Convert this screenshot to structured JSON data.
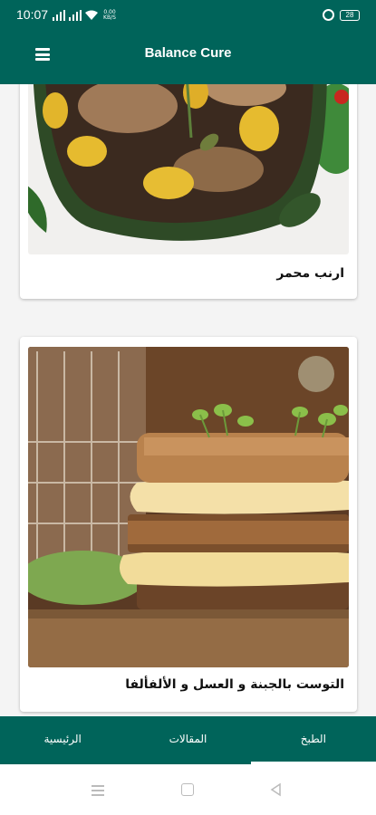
{
  "status_bar": {
    "time": "10:07",
    "net_speed": "0.00\nKB/S",
    "battery": "28"
  },
  "app_bar": {
    "title": "Balance Cure",
    "menu_icon": "hamburger-menu-icon"
  },
  "articles": [
    {
      "title": "ارنب محمر",
      "image": "braised-rabbit-with-potatoes-photo"
    },
    {
      "title": "التوست بالجبنة و العسل و الألفألفا",
      "image": "cheese-honey-alfalfa-toast-photo"
    }
  ],
  "tabs": [
    {
      "label": "الرئيسية",
      "active": false
    },
    {
      "label": "المقالات",
      "active": false
    },
    {
      "label": "الطبخ",
      "active": true
    }
  ],
  "colors": {
    "primary": "#00645a",
    "background": "#f4f4f4"
  }
}
